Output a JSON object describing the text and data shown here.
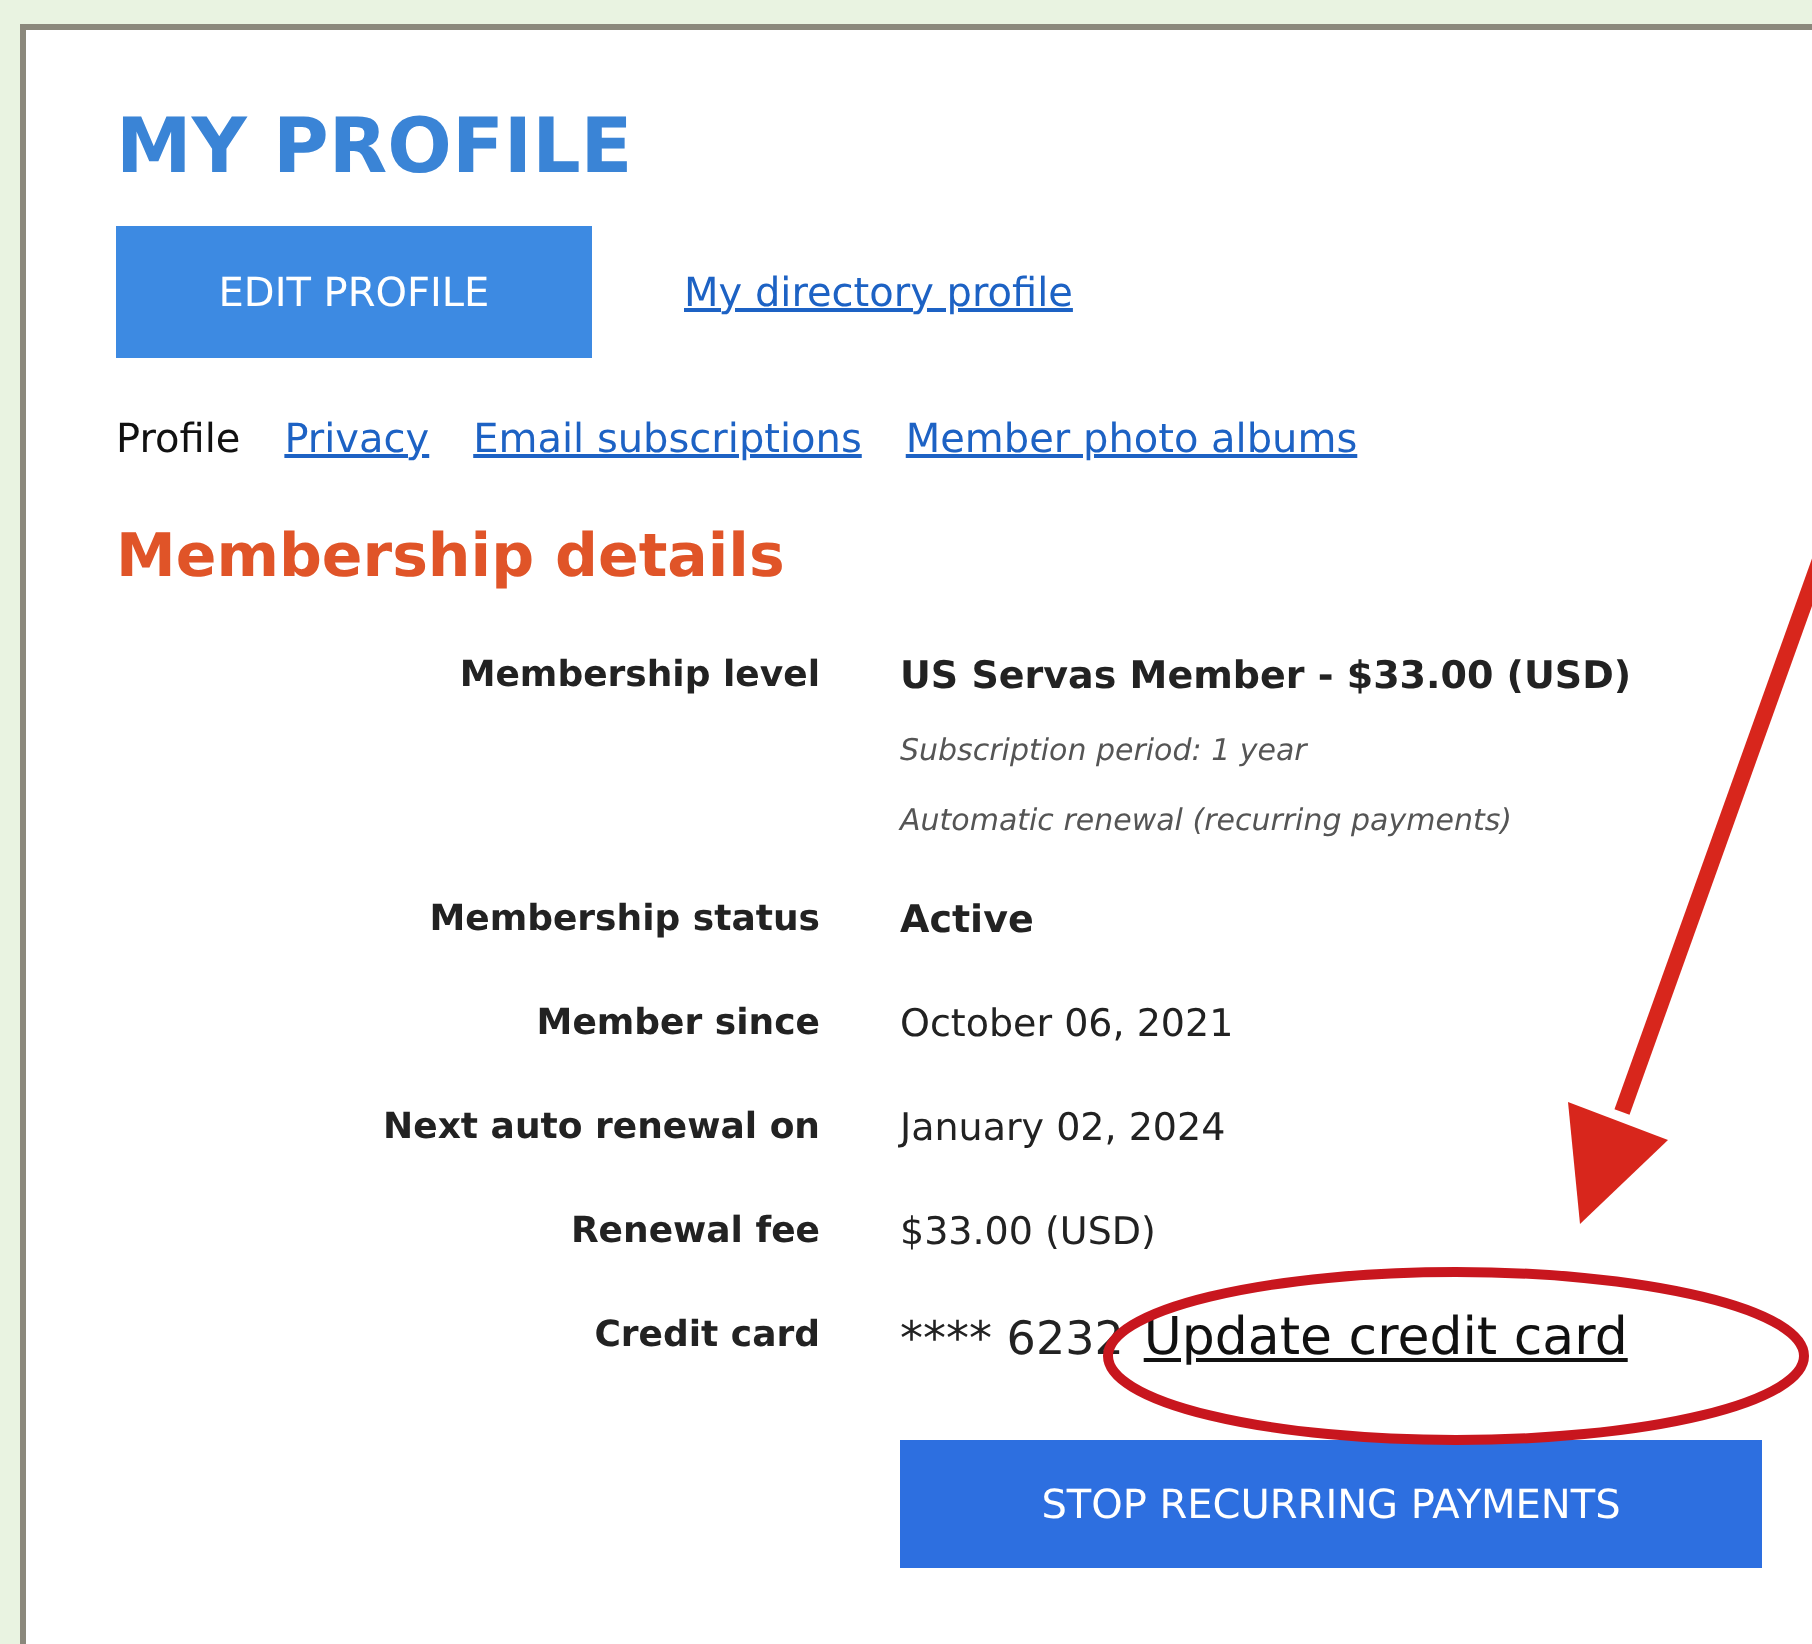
{
  "page": {
    "title": "MY PROFILE",
    "edit_button": "EDIT PROFILE",
    "directory_link": "My directory profile"
  },
  "tabs": [
    {
      "label": "Profile",
      "selected": true
    },
    {
      "label": "Privacy",
      "selected": false
    },
    {
      "label": "Email subscriptions",
      "selected": false
    },
    {
      "label": "Member photo albums",
      "selected": false
    }
  ],
  "section": {
    "heading": "Membership details",
    "rows": [
      {
        "label": "Membership level",
        "value": "US Servas Member - $33.00 (USD)",
        "emphasis": true,
        "notes": [
          "Subscription period: 1 year",
          "Automatic renewal (recurring payments)"
        ]
      },
      {
        "label": "Membership status",
        "value": "Active",
        "emphasis": true
      },
      {
        "label": "Member since",
        "value": "October 06, 2021",
        "emphasis": false
      },
      {
        "label": "Next auto renewal on",
        "value": "January 02, 2024",
        "emphasis": false
      },
      {
        "label": "Renewal fee",
        "value": "$33.00 (USD)",
        "emphasis": false
      },
      {
        "label": "Credit card",
        "value": "**** 6232",
        "emphasis": false,
        "link": "Update credit card"
      }
    ],
    "button": "STOP RECURRING PAYMENTS"
  }
}
